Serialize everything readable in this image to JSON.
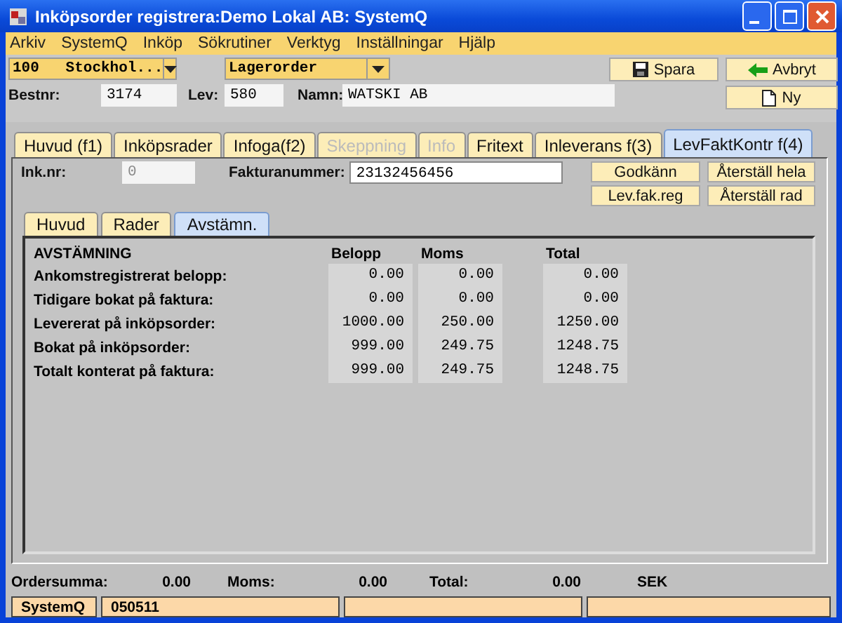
{
  "window": {
    "title": "Inköpsorder registrera:Demo Lokal AB: SystemQ"
  },
  "menu": [
    "Arkiv",
    "SystemQ",
    "Inköp",
    "Sökrutiner",
    "Verktyg",
    "Inställningar",
    "Hjälp"
  ],
  "header": {
    "warehouse": "100   Stockhol...",
    "order_type": "Lagerorder",
    "fields": [
      {
        "label": "Bestnr:",
        "value": "3174"
      },
      {
        "label": "Lev:",
        "value": "580"
      },
      {
        "label": "Namn:",
        "value": "WATSKI AB"
      }
    ],
    "buttons": [
      "Spara",
      "Avbryt",
      "Ny"
    ]
  },
  "tabs": [
    {
      "label": "Huvud (f1)",
      "selected": false,
      "disabled": false
    },
    {
      "label": "Inköpsrader",
      "selected": false,
      "disabled": false
    },
    {
      "label": "Infoga(f2)",
      "selected": false,
      "disabled": false
    },
    {
      "label": "Skeppning",
      "selected": false,
      "disabled": true
    },
    {
      "label": "Info",
      "selected": false,
      "disabled": true
    },
    {
      "label": "Fritext",
      "selected": false,
      "disabled": false
    },
    {
      "label": "Inleverans f(3)",
      "selected": false,
      "disabled": false
    },
    {
      "label": "LevFaktKontr f(4)",
      "selected": true,
      "disabled": false
    }
  ],
  "invoice": {
    "ink_nr": {
      "label": "Ink.nr:",
      "value": "0",
      "disabled": true
    },
    "invoice_number": {
      "label": "Fakturanummer:",
      "value": "23132456456"
    },
    "buttons": [
      "Godkänn",
      "Återställ hela",
      "Lev.fak.reg",
      "Återställ rad"
    ]
  },
  "subtabs": [
    {
      "label": "Huvud",
      "selected": false
    },
    {
      "label": "Rader",
      "selected": false
    },
    {
      "label": "Avstämn.",
      "selected": true
    }
  ],
  "reconciliation": {
    "columns": [
      "AVSTÄMNING",
      "Belopp",
      "Moms",
      "Total"
    ],
    "rows": [
      {
        "label": "Ankomstregistrerat belopp:",
        "values": [
          "0.00",
          "0.00",
          "0.00"
        ]
      },
      {
        "label": "Tidigare bokat på faktura:",
        "values": [
          "0.00",
          "0.00",
          "0.00"
        ]
      },
      {
        "label": "Levererat på inköpsorder:",
        "values": [
          "1000.00",
          "250.00",
          "1250.00"
        ]
      },
      {
        "label": "Bokat på inköpsorder:",
        "values": [
          "999.00",
          "249.75",
          "1248.75"
        ]
      },
      {
        "label": "Totalt konterat på faktura:",
        "values": [
          "999.00",
          "249.75",
          "1248.75"
        ]
      }
    ]
  },
  "totals": [
    {
      "label": "Ordersumma:",
      "value": "0.00"
    },
    {
      "label": "Moms:",
      "value": "0.00"
    },
    {
      "label": "Total:",
      "value": "0.00"
    }
  ],
  "currency": "SEK",
  "status_bar": [
    "SystemQ",
    "050511"
  ]
}
